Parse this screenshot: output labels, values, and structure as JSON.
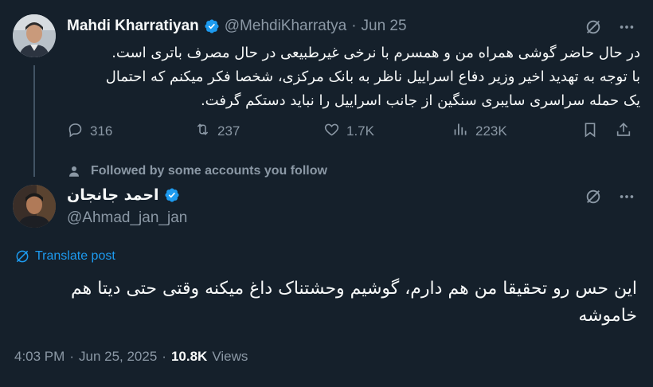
{
  "parent_tweet": {
    "author_name": "Mahdi Kharratiyan",
    "handle": "@MehdiKharratya",
    "separator": "·",
    "date": "Jun 25",
    "text_lines": [
      "در حال حاضر گوشی همراه من و همسرم با نرخی غیرطبیعی در حال مصرف باتری است.",
      "با توجه به تهدید اخیر وزیر دفاع اسراییل ناظر به بانک مرکزی، شخصا فکر میکنم که احتمال",
      "یک حمله سراسری سایبری سنگین از جانب اسراییل را نباید دستکم گرفت."
    ],
    "replies": "316",
    "reposts": "237",
    "likes": "1.7K",
    "views": "223K"
  },
  "social_context": "Followed by some accounts you follow",
  "main_tweet": {
    "author_name": "احمد جانجان",
    "handle": "@Ahmad_jan_jan",
    "translate_label": "Translate post",
    "text_lines": [
      "این حس رو تحقیقا من هم دارم، گوشیم وحشتناک داغ میکنه وقتی حتی دیتا هم",
      "خاموشه"
    ],
    "time": "4:03 PM",
    "dot": "·",
    "date": "Jun 25, 2025",
    "dot2": "·",
    "views_count": "10.8K",
    "views_label": "Views"
  },
  "colors": {
    "background": "#15202b",
    "text": "#f7f9f9",
    "muted": "#8b98a5",
    "link": "#1d9bf0",
    "verified": "#1d9bf0"
  },
  "icons": [
    "reply-icon",
    "repost-icon",
    "like-icon",
    "views-icon",
    "bookmark-icon",
    "share-icon",
    "grok-icon",
    "more-icon",
    "person-icon",
    "globe-icon",
    "verified-icon"
  ]
}
